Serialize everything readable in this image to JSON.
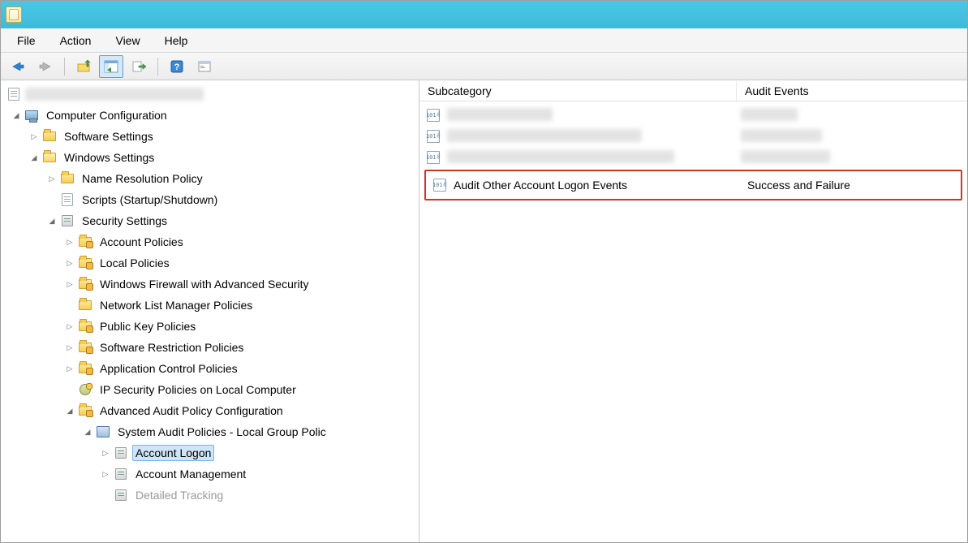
{
  "menu": {
    "file": "File",
    "action": "Action",
    "view": "View",
    "help": "Help"
  },
  "columns": {
    "subcategory": "Subcategory",
    "audit_events": "Audit Events"
  },
  "tree": {
    "computer_configuration": "Computer Configuration",
    "software_settings": "Software Settings",
    "windows_settings": "Windows Settings",
    "name_resolution_policy": "Name Resolution Policy",
    "scripts": "Scripts (Startup/Shutdown)",
    "security_settings": "Security Settings",
    "account_policies": "Account Policies",
    "local_policies": "Local Policies",
    "windows_firewall": "Windows Firewall with Advanced Security",
    "network_list": "Network List Manager Policies",
    "public_key": "Public Key Policies",
    "software_restriction": "Software Restriction Policies",
    "app_control": "Application Control Policies",
    "ip_security": "IP Security Policies on Local Computer",
    "advanced_audit": "Advanced Audit Policy Configuration",
    "system_audit": "System Audit Policies - Local Group Polic",
    "account_logon": "Account Logon",
    "account_management": "Account Management",
    "detailed_tracking": "Detailed Tracking"
  },
  "list": {
    "highlighted": {
      "subcategory": "Audit Other Account Logon Events",
      "events": "Success and Failure"
    }
  }
}
